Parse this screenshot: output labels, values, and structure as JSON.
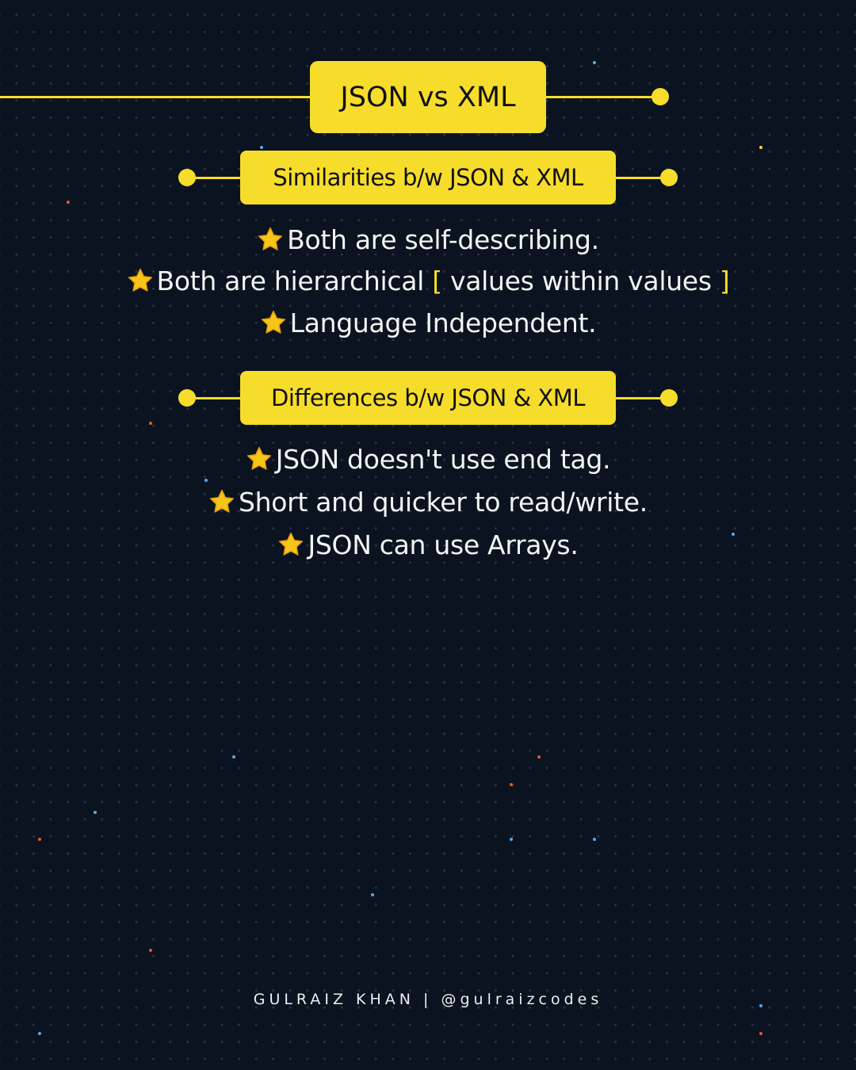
{
  "title": "JSON vs XML",
  "sections": [
    {
      "heading": "Similarities b/w JSON & XML",
      "items": [
        {
          "text": "Both are self-describing."
        },
        {
          "pre": "Both are hierarchical ",
          "open": "[",
          "mid": " values within values ",
          "close": "]"
        },
        {
          "text": "Language Independent."
        }
      ]
    },
    {
      "heading": "Differences b/w JSON & XML",
      "items": [
        {
          "text": "JSON doesn't use end tag."
        },
        {
          "text": "Short and quicker to read/write."
        },
        {
          "text": "JSON can use Arrays."
        }
      ]
    }
  ],
  "footer": "GULRAIZ KHAN | @gulraizcodes",
  "icons": {
    "bullet": "star-icon"
  },
  "colors": {
    "accent": "#f7dd2b",
    "background": "#0b1320",
    "text": "#f4f4f4",
    "star": "#f5c518"
  }
}
